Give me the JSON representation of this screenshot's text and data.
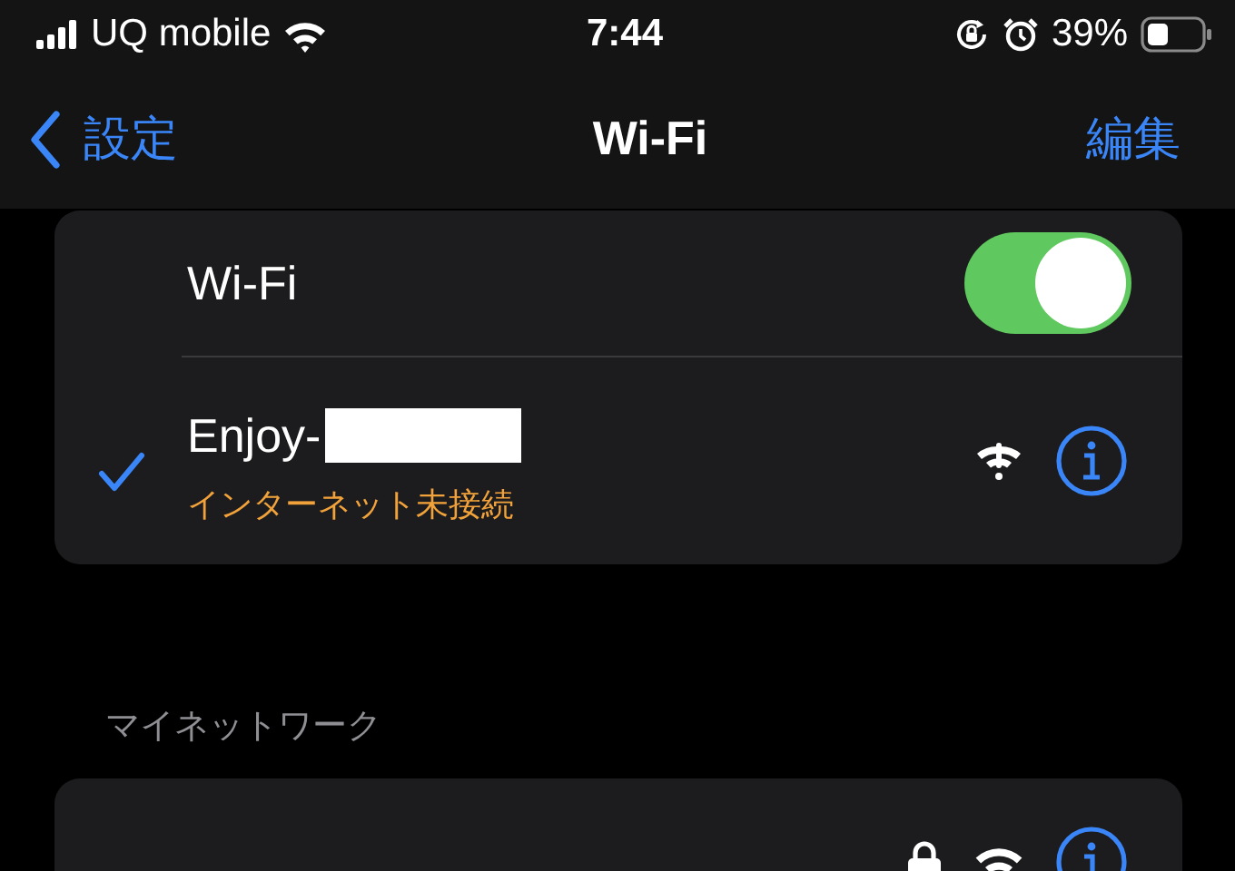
{
  "status_bar": {
    "carrier": "UQ mobile",
    "time": "7:44",
    "battery": "39%"
  },
  "nav": {
    "back": "設定",
    "title": "Wi-Fi",
    "action": "編集"
  },
  "wifi": {
    "label": "Wi-Fi",
    "on": true
  },
  "current_network": {
    "name": "Enjoy-",
    "selected": true,
    "status": "インターネット未接続",
    "kind": "no-internet"
  },
  "my_networks": {
    "header": "マイネットワーク",
    "networks": [
      {
        "kind": "locked"
      }
    ]
  }
}
